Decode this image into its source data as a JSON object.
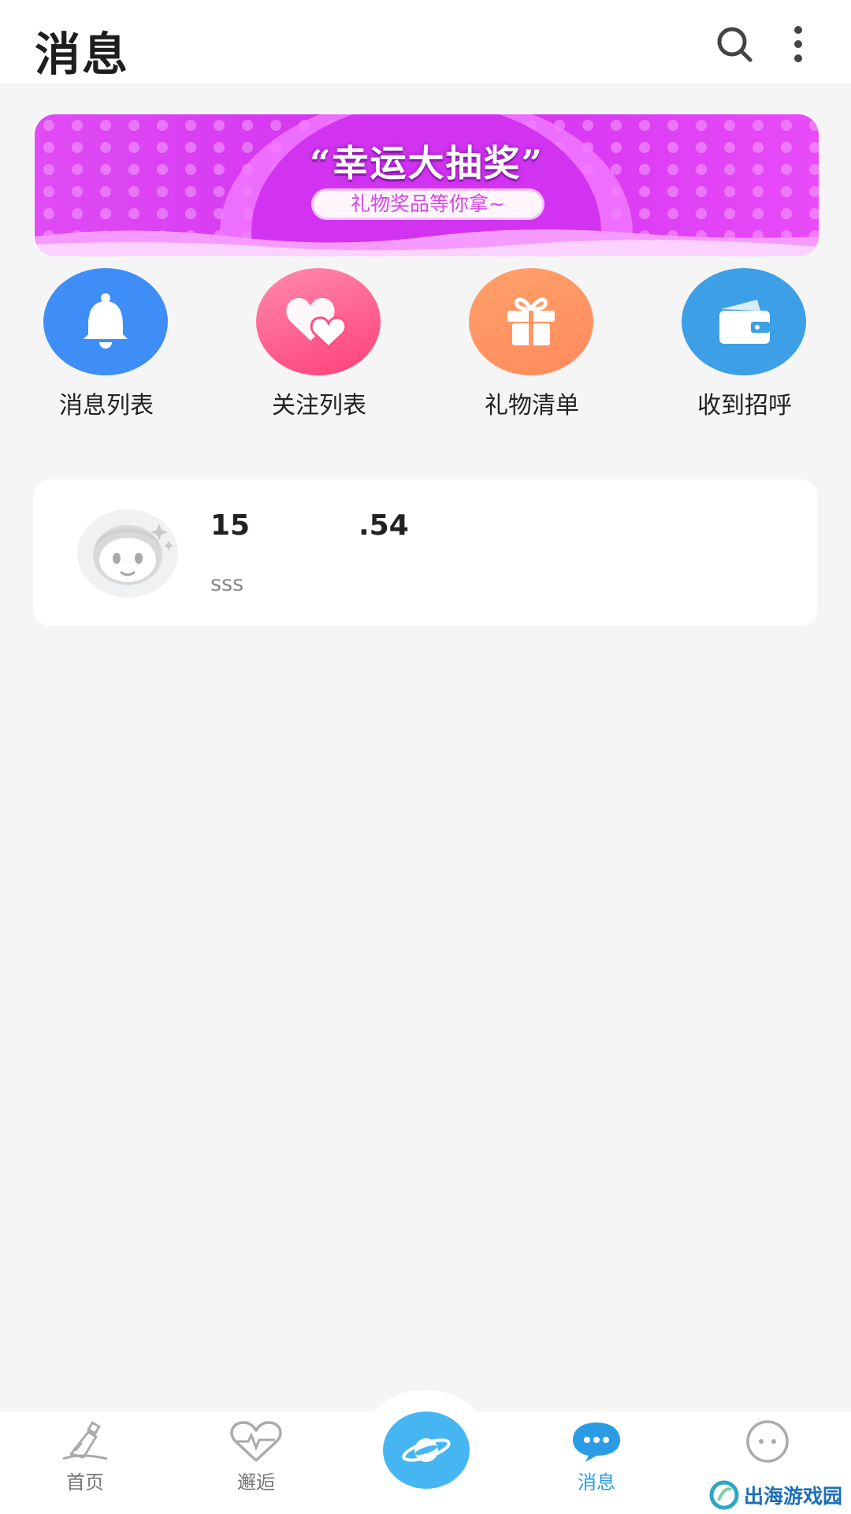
{
  "header": {
    "title": "消息",
    "search_icon": "search-icon",
    "more_icon": "more-vertical-icon"
  },
  "banner": {
    "headline": "“幸运大抽奖”",
    "subtitle": "礼物奖品等你拿~",
    "colors": {
      "primary": "#d633f2",
      "light": "#f089ff"
    }
  },
  "quick_menu": [
    {
      "label": "消息列表",
      "icon": "bell-icon",
      "color": "#3f8df7"
    },
    {
      "label": "关注列表",
      "icon": "hearts-icon",
      "color": "#ff4f85"
    },
    {
      "label": "礼物清单",
      "icon": "gift-icon",
      "color": "#ff9a66"
    },
    {
      "label": "收到招呼",
      "icon": "wallet-icon",
      "color": "#3d9fe6"
    }
  ],
  "conversations": [
    {
      "name": "15           .54",
      "preview": "sss",
      "avatar_icon": "default-avatar-icon"
    }
  ],
  "bottom_nav": [
    {
      "label": "首页",
      "icon": "bottle-icon",
      "active": false
    },
    {
      "label": "邂逅",
      "icon": "heartbeat-icon",
      "active": false
    },
    {
      "label": "",
      "icon": "planet-icon",
      "active": false
    },
    {
      "label": "消息",
      "icon": "chat-icon",
      "active": true
    },
    {
      "label": "",
      "icon": "smiley-icon",
      "active": false
    }
  ],
  "watermark": {
    "text": "出海游戏园"
  },
  "colors": {
    "accent": "#2b9be5",
    "background": "#f5f5f5"
  }
}
